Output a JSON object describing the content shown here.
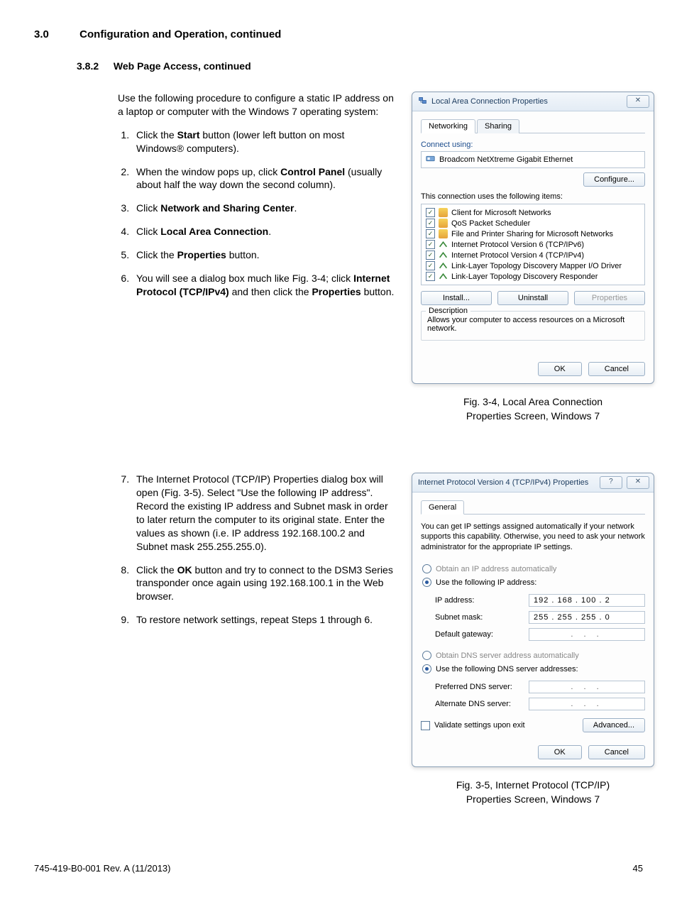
{
  "heading": {
    "num": "3.0",
    "title": "Configuration and Operation, continued"
  },
  "subheading": {
    "num": "3.8.2",
    "title": "Web Page Access, continued"
  },
  "intro": "Use the following procedure to configure a static IP address on a laptop or computer with the Windows 7 operating system:",
  "steps_a": [
    {
      "pre": "Click the ",
      "bold": "Start",
      "post": " button (lower left button on most Windows® computers)."
    },
    {
      "pre": "When the window pops up, click ",
      "bold": "Control Panel",
      "post": " (usually about half the way down the second column)."
    },
    {
      "pre": "Click ",
      "bold": "Network and Sharing Center",
      "post": "."
    },
    {
      "pre": "Click ",
      "bold": "Local Area Connection",
      "post": "."
    },
    {
      "pre": "Click the ",
      "bold": "Properties",
      "post": " button."
    },
    {
      "pre": "You will see a dialog box much like Fig. 3-4; click ",
      "bold": "Internet Protocol (TCP/IPv4)",
      "post": " and then click the ",
      "bold2": "Properties",
      "post2": " button."
    }
  ],
  "steps_b_start": 7,
  "steps_b": [
    "The Internet Protocol (TCP/IP) Properties dialog box will open (Fig. 3-5). Select \"Use the following IP address\". Record the existing IP address and Subnet mask in order to later return the computer to its original state. Enter the  values as shown (i.e. IP address 192.168.100.2 and Subnet mask 255.255.255.0).",
    "",
    "To restore network settings, repeat Steps 1 through 6."
  ],
  "step8": {
    "pre": "Click the ",
    "bold": "OK",
    "post": " button and try to connect to the DSM3 Series transponder once again using 192.168.100.1 in the Web browser."
  },
  "fig1_caption_l1": "Fig. 3-4, Local Area Connection",
  "fig1_caption_l2": "Properties Screen, Windows 7",
  "fig2_caption_l1": "Fig. 3-5, Internet Protocol (TCP/IP)",
  "fig2_caption_l2": "Properties Screen, Windows 7",
  "dialog1": {
    "title": "Local Area Connection Properties",
    "tabs": [
      "Networking",
      "Sharing"
    ],
    "connect_using_label": "Connect using:",
    "adapter": "Broadcom NetXtreme Gigabit Ethernet",
    "configure_btn": "Configure...",
    "items_label": "This connection uses the following items:",
    "items": [
      "Client for Microsoft Networks",
      "QoS Packet Scheduler",
      "File and Printer Sharing for Microsoft Networks",
      "Internet Protocol Version 6 (TCP/IPv6)",
      "Internet Protocol Version 4 (TCP/IPv4)",
      "Link-Layer Topology Discovery Mapper I/O Driver",
      "Link-Layer Topology Discovery Responder"
    ],
    "install_btn": "Install...",
    "uninstall_btn": "Uninstall",
    "properties_btn": "Properties",
    "desc_legend": "Description",
    "desc_text": "Allows your computer to access resources on a Microsoft network.",
    "ok": "OK",
    "cancel": "Cancel"
  },
  "dialog2": {
    "title": "Internet Protocol Version 4 (TCP/IPv4) Properties",
    "tab": "General",
    "blurb": "You can get IP settings assigned automatically if your network supports this capability. Otherwise, you need to ask your network administrator for the appropriate IP settings.",
    "radio_auto_ip": "Obtain an IP address automatically",
    "radio_use_ip": "Use the following IP address:",
    "ip_label": "IP address:",
    "ip_value": "192 . 168 . 100 .   2",
    "subnet_label": "Subnet mask:",
    "subnet_value": "255 . 255 . 255 .   0",
    "gateway_label": "Default gateway:",
    "radio_auto_dns": "Obtain DNS server address automatically",
    "radio_use_dns": "Use the following DNS server addresses:",
    "pref_dns_label": "Preferred DNS server:",
    "alt_dns_label": "Alternate DNS server:",
    "validate_label": "Validate settings upon exit",
    "advanced_btn": "Advanced...",
    "ok": "OK",
    "cancel": "Cancel"
  },
  "footer_left": "745-419-B0-001 Rev. A (11/2013)",
  "footer_right": "45"
}
